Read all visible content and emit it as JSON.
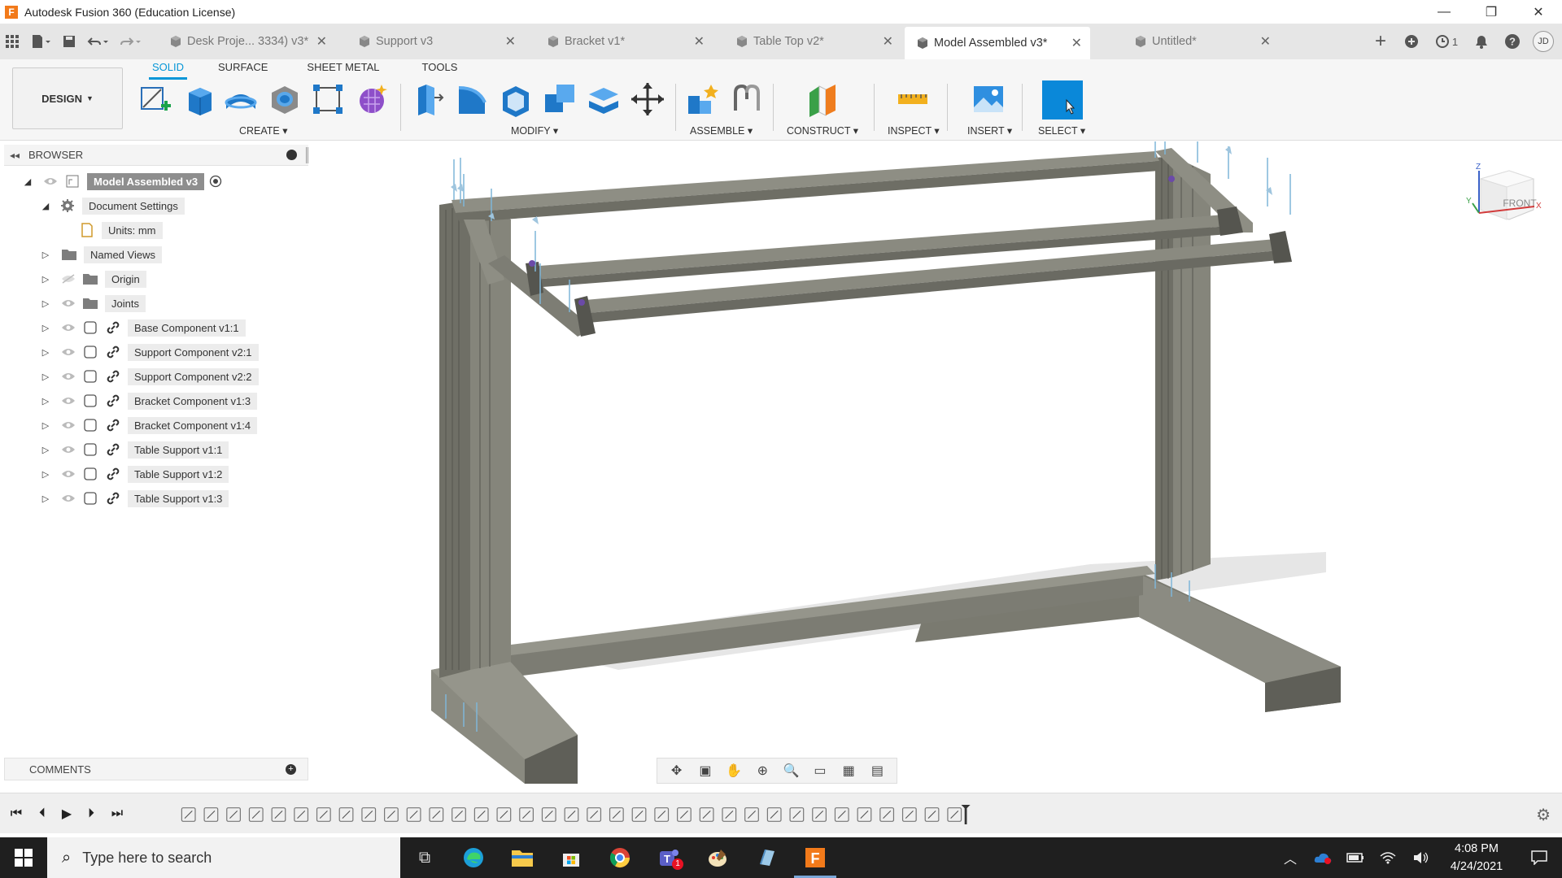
{
  "window": {
    "title": "Autodesk Fusion 360 (Education License)",
    "logo_letter": "F",
    "controls": [
      "—",
      "❐",
      "✕"
    ]
  },
  "tabs": [
    {
      "label": "Desk Proje... 3334) v3*",
      "active": false
    },
    {
      "label": "Support v3",
      "active": false
    },
    {
      "label": "Bracket v1*",
      "active": false
    },
    {
      "label": "Table Top v2*",
      "active": false
    },
    {
      "label": "Model Assembled v3*",
      "active": true
    },
    {
      "label": "Untitled*",
      "active": false
    }
  ],
  "tab_bar_right": {
    "job_count": "1",
    "user_initials": "JD"
  },
  "toolbar": {
    "workspace": "DESIGN",
    "workspace_tabs": [
      "SOLID",
      "SURFACE",
      "SHEET METAL",
      "TOOLS"
    ],
    "active_workspace_tab": "SOLID",
    "groups": {
      "create": "CREATE",
      "modify": "MODIFY",
      "assemble": "ASSEMBLE",
      "construct": "CONSTRUCT",
      "inspect": "INSPECT",
      "insert": "INSERT",
      "select": "SELECT"
    },
    "accent_color": "#0696d7"
  },
  "browser": {
    "title": "BROWSER",
    "root": "Model Assembled v3",
    "document_settings": "Document Settings",
    "units": "Units: mm",
    "items": [
      {
        "label": "Named Views",
        "icon": "folder-icon"
      },
      {
        "label": "Origin",
        "icon": "folder-icon"
      },
      {
        "label": "Joints",
        "icon": "folder-icon"
      },
      {
        "label": "Base Component v1:1",
        "icon": "component-icon"
      },
      {
        "label": "Support Component v2:1",
        "icon": "component-icon"
      },
      {
        "label": "Support Component v2:2",
        "icon": "component-icon"
      },
      {
        "label": "Bracket Component v1:3",
        "icon": "component-icon"
      },
      {
        "label": "Bracket Component v1:4",
        "icon": "component-icon"
      },
      {
        "label": "Table Support v1:1",
        "icon": "component-icon"
      },
      {
        "label": "Table Support v1:2",
        "icon": "component-icon"
      },
      {
        "label": "Table Support v1:3",
        "icon": "component-icon"
      }
    ]
  },
  "comments": {
    "title": "COMMENTS"
  },
  "viewcube": {
    "face": "FRONT",
    "axes": [
      "Z",
      "Y",
      "X"
    ]
  },
  "taskbar": {
    "search_placeholder": "Type here to search",
    "time": "4:08 PM",
    "date": "4/24/2021",
    "teams_badge": "1"
  }
}
